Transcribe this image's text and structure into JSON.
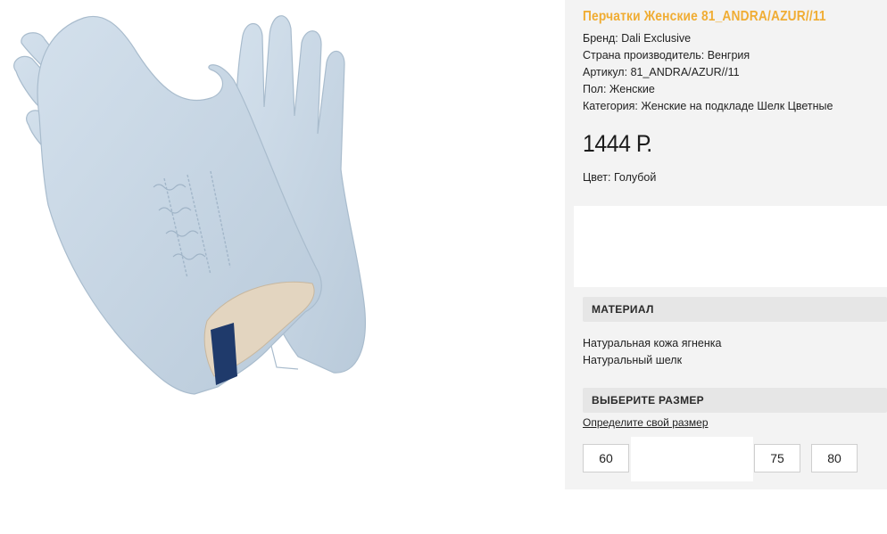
{
  "product": {
    "title": "Перчатки Женские 81_ANDRA/AZUR//11",
    "specs": [
      {
        "label": "Бренд:",
        "value": "Dali Exclusive"
      },
      {
        "label": "Страна производитель:",
        "value": "Венгрия"
      },
      {
        "label": "Артикул:",
        "value": "81_ANDRA/AZUR//11"
      },
      {
        "label": "Пол:",
        "value": "Женские"
      },
      {
        "label": "Категория:",
        "value": "Женские на подкладе Шелк Цветные"
      }
    ],
    "price": "1444 Р.",
    "color_label": "Цвет:",
    "color_value": "Голубой"
  },
  "material": {
    "header": "МАТЕРИАЛ",
    "items": [
      "Натуральная кожа ягненка",
      "Натуральный шелк"
    ]
  },
  "size": {
    "header": "ВЫБЕРИТЕ РАЗМЕР",
    "link": "Определите свой размер",
    "options": [
      "60",
      "75",
      "80"
    ]
  },
  "image": {
    "icon": "gloves-photo",
    "glove_color": "#c9d8e6",
    "lining_color": "#e3d5c0",
    "label_color": "#1f3a6b"
  },
  "colors": {
    "title_accent": "#f0ad34",
    "panel_bg": "#f3f3f3",
    "header_bg": "#e6e6e6"
  }
}
